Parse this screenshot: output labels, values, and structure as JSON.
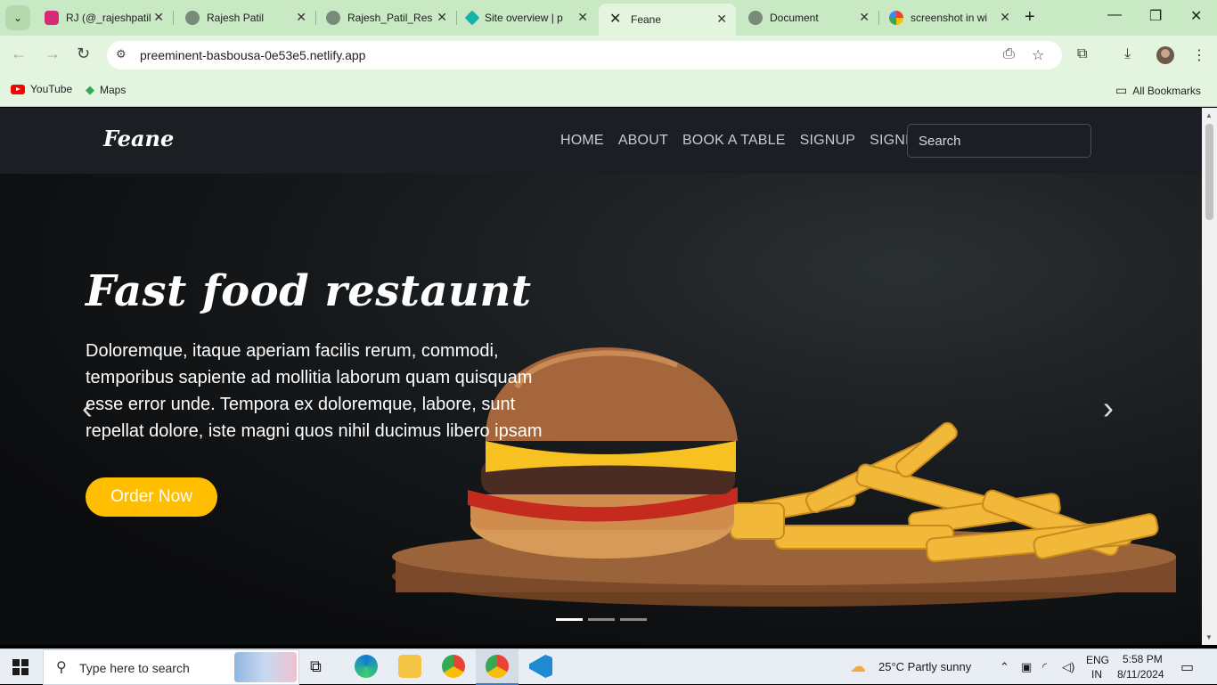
{
  "browser": {
    "tabs": [
      {
        "title": "RJ (@_rajeshpatil",
        "fav_color": "#d62976"
      },
      {
        "title": "Rajesh Patil",
        "fav_color": "#7a8a7a"
      },
      {
        "title": "Rajesh_Patil_Res",
        "fav_color": "#7a8a7a"
      },
      {
        "title": "Site overview | p",
        "fav_color": "#15b3a7"
      },
      {
        "title": "Feane",
        "fav_color": "#1f1f1f"
      },
      {
        "title": "Document",
        "fav_color": "#7a8a7a"
      },
      {
        "title": "screenshot in wi",
        "fav_color": "#4285f4"
      }
    ],
    "url": "preeminent-basbousa-0e53e5.netlify.app",
    "bookmarks": {
      "youtube": "YouTube",
      "maps": "Maps",
      "all": "All Bookmarks"
    }
  },
  "site": {
    "logo": "Feane",
    "nav": [
      "HOME",
      "ABOUT",
      "BOOK A TABLE",
      "SIGNUP",
      "SIGNIN"
    ],
    "search_placeholder": "Search",
    "hero": {
      "title": "Fast food restaunt",
      "text": "Doloremque, itaque aperiam facilis rerum, commodi, temporibus sapiente ad mollitia laborum quam quisquam esse error unde. Tempora ex doloremque, labore, sunt repellat dolore, iste magni quos nihil ducimus libero ipsam",
      "button": "Order Now",
      "active_slide": 1,
      "slide_count": 3
    },
    "accent_color": "#ffbe00"
  },
  "taskbar": {
    "search_text": "Type here to search",
    "weather": "25°C  Partly sunny",
    "lang": "ENG",
    "region": "IN",
    "time": "5:58 PM",
    "date": "8/11/2024"
  }
}
